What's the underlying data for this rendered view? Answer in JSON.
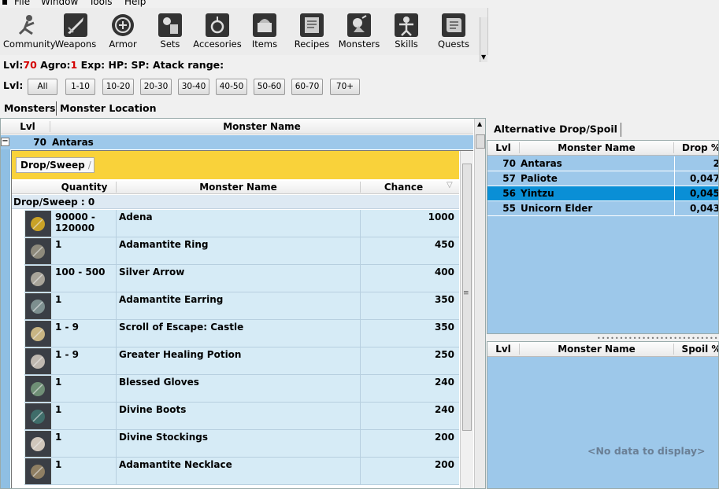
{
  "menu": [
    "File",
    "Window",
    "Tools",
    "Help"
  ],
  "toolbar": [
    {
      "label": "Community",
      "icon": "community-icon"
    },
    {
      "label": "Weapons",
      "icon": "sword-icon"
    },
    {
      "label": "Armor",
      "icon": "armor-icon"
    },
    {
      "label": "Sets",
      "icon": "sets-icon"
    },
    {
      "label": "Accesories",
      "icon": "accessories-icon"
    },
    {
      "label": "Items",
      "icon": "items-icon"
    },
    {
      "label": "Recipes",
      "icon": "recipes-icon"
    },
    {
      "label": "Monsters",
      "icon": "monsters-icon"
    },
    {
      "label": "Skills",
      "icon": "skills-icon"
    },
    {
      "label": "Quests",
      "icon": "quests-icon"
    }
  ],
  "stats": {
    "lvl_label": "Lvl:",
    "lvl_value": "70",
    "agro_label": "Agro:",
    "agro_value": "1",
    "exp_label": "Exp:",
    "hp_label": "HP:",
    "sp_label": "SP:",
    "range_label": "Atack range:"
  },
  "level_filter": {
    "label": "Lvl:",
    "buttons": [
      "All",
      "1-10",
      "10-20",
      "20-30",
      "30-40",
      "40-50",
      "50-60",
      "60-70",
      "70+"
    ]
  },
  "tabs": [
    "Monsters",
    "Monster Location"
  ],
  "monster_grid": {
    "col_lvl": "Lvl",
    "col_name": "Monster Name",
    "row": {
      "lvl": "70",
      "name": "Antaras",
      "expander": "−"
    }
  },
  "drop_detail": {
    "group_chip": "Drop/Sweep",
    "col_quantity": "Quantity",
    "col_name": "Monster Name",
    "col_chance": "Chance",
    "group_row": "Drop/Sweep : 0",
    "rows": [
      {
        "qty": "90000 - 120000",
        "name": "Adena",
        "chance": "1000",
        "icon": "adena-icon"
      },
      {
        "qty": "1",
        "name": "Adamantite Ring",
        "chance": "450",
        "icon": "ring-icon"
      },
      {
        "qty": "100 - 500",
        "name": "Silver Arrow",
        "chance": "400",
        "icon": "arrow-icon"
      },
      {
        "qty": "1",
        "name": "Adamantite Earring",
        "chance": "350",
        "icon": "earring-icon"
      },
      {
        "qty": "1 - 9",
        "name": "Scroll of Escape: Castle",
        "chance": "350",
        "icon": "scroll-icon"
      },
      {
        "qty": "1 - 9",
        "name": "Greater Healing Potion",
        "chance": "250",
        "icon": "potion-icon"
      },
      {
        "qty": "1",
        "name": "Blessed Gloves",
        "chance": "240",
        "icon": "gloves-icon"
      },
      {
        "qty": "1",
        "name": "Divine Boots",
        "chance": "240",
        "icon": "boots-icon"
      },
      {
        "qty": "1",
        "name": "Divine Stockings",
        "chance": "200",
        "icon": "stockings-icon"
      },
      {
        "qty": "1",
        "name": "Adamantite Necklace",
        "chance": "200",
        "icon": "necklace-icon"
      }
    ]
  },
  "alt_drop": {
    "title": "Alternative Drop/Spoil",
    "drop_grid": {
      "col_lvl": "Lvl",
      "col_name": "Monster Name",
      "col_value": "Drop %",
      "rows": [
        {
          "lvl": "70",
          "name": "Antaras",
          "value": "2"
        },
        {
          "lvl": "57",
          "name": "Paliote",
          "value": "0,047"
        },
        {
          "lvl": "56",
          "name": "Yintzu",
          "value": "0,045"
        },
        {
          "lvl": "55",
          "name": "Unicorn Elder",
          "value": "0,043"
        }
      ]
    },
    "spoil_grid": {
      "col_lvl": "Lvl",
      "col_name": "Monster Name",
      "col_value": "Spoil %",
      "empty_text": "<No data to display>"
    }
  },
  "colors": {
    "selection": "#0a8fd6",
    "row_blue": "#9dc8ea",
    "group_yellow": "#f9d23a",
    "accent_red": "#d40000"
  }
}
